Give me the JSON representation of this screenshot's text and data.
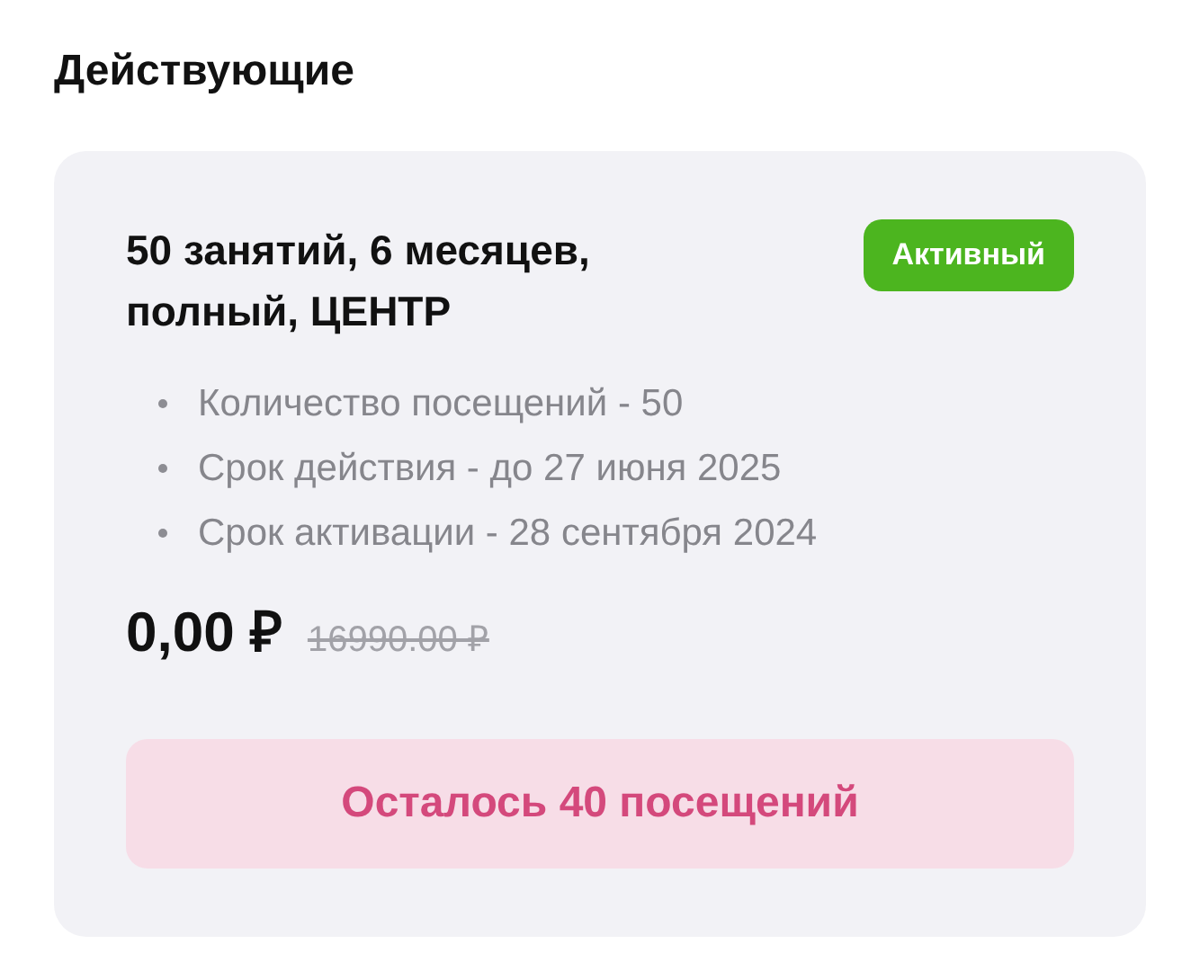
{
  "section_title": "Действующие",
  "subscription": {
    "title": "50 занятий, 6 месяцев, полный, ЦЕНТР",
    "status": {
      "label": "Активный",
      "kind": "active"
    },
    "details": [
      "Количество посещений - 50",
      "Срок действия - до 27 июня 2025",
      "Срок активации - 28 сентября 2024"
    ],
    "price": "0,00 ₽",
    "old_price": "16990.00 ₽",
    "remaining_button": "Осталось 40 посещений"
  }
}
